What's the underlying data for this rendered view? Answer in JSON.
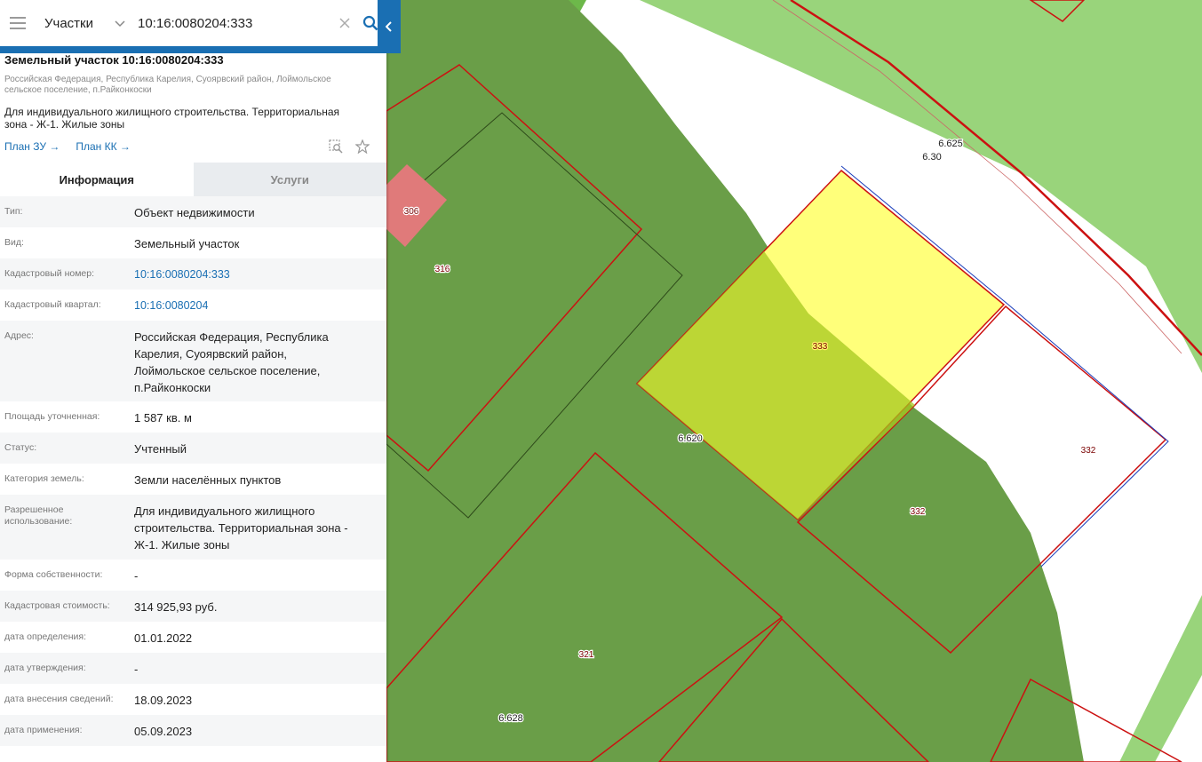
{
  "search": {
    "layer": "Участки",
    "query": "10:16:0080204:333"
  },
  "parcel": {
    "title": "Земельный участок 10:16:0080204:333",
    "address_line1": "Российская Федерация, Республика Карелия, Суоярвский район, Лоймольское",
    "address_line2": "сельское поселение, п.Райконкоски",
    "purpose_line1": "Для индивидуального жилищного строительства. Территориальная",
    "purpose_line2": "зона - Ж-1. Жилые зоны",
    "link_plan_zu": "План ЗУ →",
    "link_plan_kk": "План КК →"
  },
  "tabs": {
    "info": "Информация",
    "services": "Услуги"
  },
  "rows": [
    {
      "k": "Тип:",
      "v": [
        "Объект недвижимости"
      ]
    },
    {
      "k": "Вид:",
      "v": [
        "Земельный участок"
      ]
    },
    {
      "k": "Кадастровый номер:",
      "v": [
        "10:16:0080204:333"
      ],
      "link": true
    },
    {
      "k": "Кадастровый квартал:",
      "v": [
        "10:16:0080204"
      ],
      "link": true
    },
    {
      "k": "Адрес:",
      "v": [
        "Российская Федерация, Республика",
        "Карелия, Суоярвский район,",
        "Лоймольское сельское поселение,",
        "п.Райконкоски"
      ]
    },
    {
      "k": "Площадь уточненная:",
      "v": [
        "1 587 кв. м"
      ]
    },
    {
      "k": "Статус:",
      "v": [
        "Учтенный"
      ]
    },
    {
      "k": "Категория земель:",
      "v": [
        "Земли населённых пунктов"
      ]
    },
    {
      "k": "Разрешенное|использование:",
      "v": [
        "Для индивидуального жилищного",
        "строительства. Территориальная зона -",
        "Ж-1. Жилые зоны"
      ]
    },
    {
      "k": "Форма собственности:",
      "v": [
        "-"
      ]
    },
    {
      "k": "Кадастровая стоимость:",
      "v": [
        "314 925,93 руб."
      ]
    },
    {
      "k": "дата определения:",
      "v": [
        "01.01.2022"
      ]
    },
    {
      "k": "дата утверждения:",
      "v": [
        "-"
      ]
    },
    {
      "k": "дата внесения сведений:",
      "v": [
        "18.09.2023"
      ]
    },
    {
      "k": "дата применения:",
      "v": [
        "05.09.2023"
      ]
    }
  ],
  "map_labels": {
    "l306": "306",
    "l316": "316",
    "l333": "333",
    "l332a": "332",
    "l332b": "332",
    "l321": "321",
    "z6625": "6.625",
    "z630": "6.30",
    "z6620": "6.620",
    "z6628": "6.628"
  },
  "colors": {
    "accent": "#1a6fb3",
    "zone_dark": "#6a9e48",
    "zone_light": "#99d47b",
    "parcel_selected": "#ffff7a",
    "parcel_border": "#cc1111",
    "parcel_pink": "#e07a7a"
  }
}
